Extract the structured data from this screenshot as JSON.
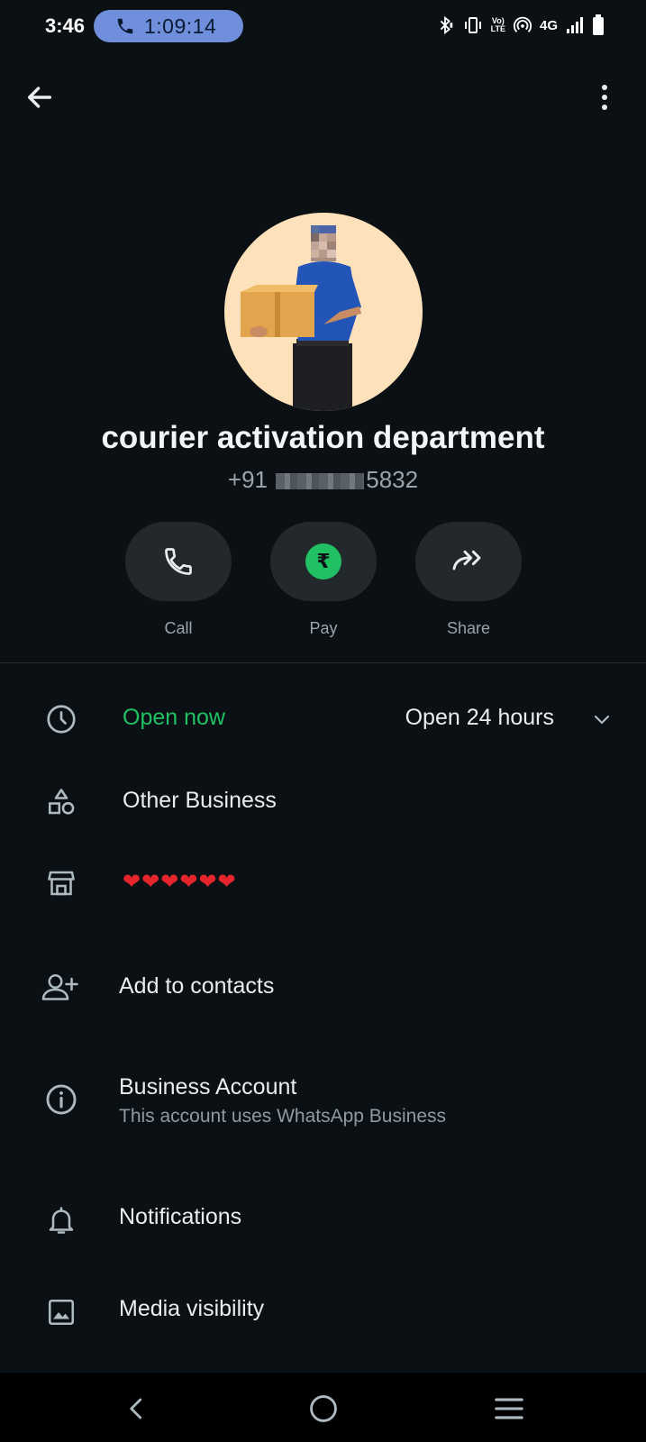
{
  "status_bar": {
    "time": "3:46",
    "call_timer": "1:09:14",
    "lte_label_top": "Vo)",
    "lte_label_bottom": "LTE",
    "network": "4G"
  },
  "contact": {
    "name": "courier activation department",
    "phone_prefix": "+91",
    "phone_suffix": "5832"
  },
  "actions": [
    {
      "label": "Call",
      "icon": "phone-icon"
    },
    {
      "label": "Pay",
      "icon": "rupee-icon",
      "symbol": "₹"
    },
    {
      "label": "Share",
      "icon": "share-forward-icon"
    }
  ],
  "hours_row": {
    "status": "Open now",
    "hours": "Open 24 hours",
    "status_color": "#21c063"
  },
  "category_row": {
    "label": "Other Business"
  },
  "description_row": {
    "text": "❤❤❤❤❤❤"
  },
  "add_contact_row": {
    "label": "Add to contacts"
  },
  "business_row": {
    "title": "Business Account",
    "subtitle": "This account uses WhatsApp Business"
  },
  "notifications_row": {
    "label": "Notifications"
  },
  "media_row": {
    "label": "Media visibility"
  },
  "colors": {
    "background": "#0b1014",
    "accent_green": "#21c063",
    "pill_blue": "#6f8fdc",
    "button_bg": "#22282c"
  }
}
